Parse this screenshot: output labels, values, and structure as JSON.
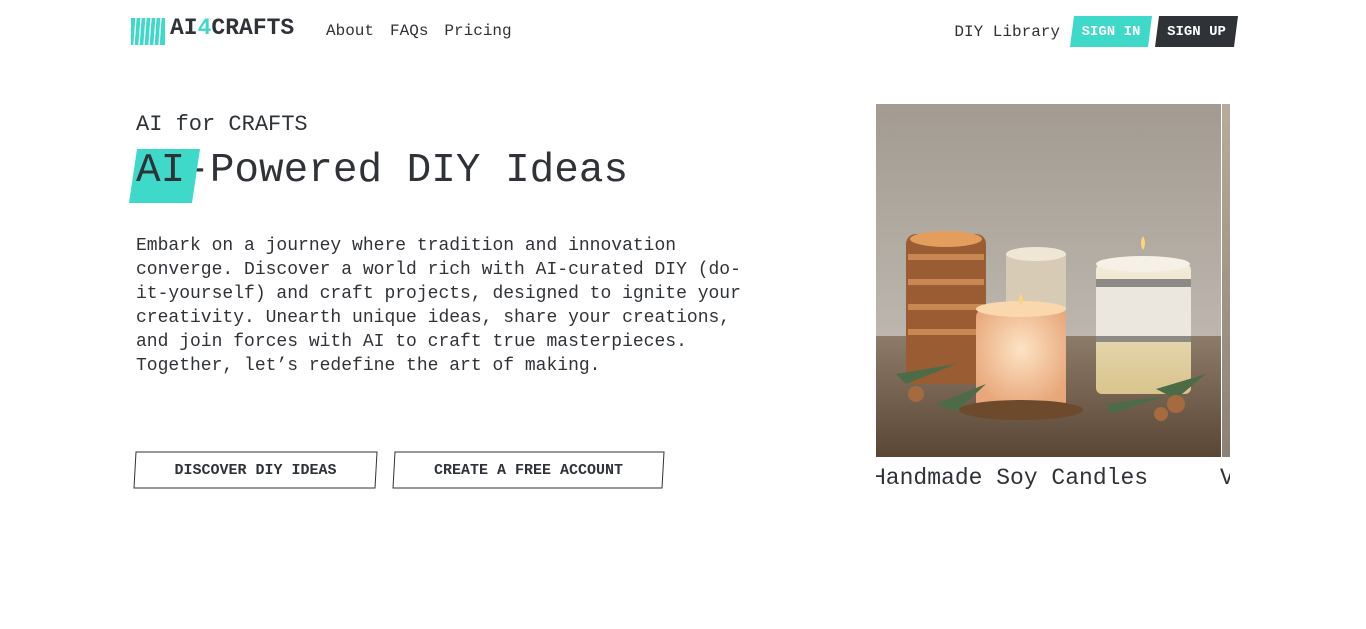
{
  "brand": {
    "prefix": "AI",
    "accent": "4",
    "suffix": "CRAFTS",
    "accent_color": "#3fd9c9",
    "dark_color": "#2f3237"
  },
  "nav": {
    "about": "About",
    "faqs": "FAQs",
    "pricing": "Pricing"
  },
  "account": {
    "library": "DIY Library",
    "sign_in": "SIGN IN",
    "sign_up": "SIGN UP"
  },
  "hero": {
    "eyebrow": "AI for CRAFTS",
    "headline_highlight": "AI",
    "headline_rest": "-Powered DIY Ideas",
    "description": "Embark on a journey where tradition and innovation converge. Discover a world rich with AI-curated DIY (do-it-yourself) and craft projects, designed to ignite your creativity. Unearth unique ideas, share your creations, and join forces with AI to craft true masterpieces. Together, let’s redefine the art of making.",
    "cta_discover": "DISCOVER DIY IDEAS",
    "cta_create": "CREATE A FREE ACCOUNT"
  },
  "carousel": {
    "slides": [
      {
        "caption": "Handmade Soy Candles",
        "image": "candles-photo"
      },
      {
        "caption": "V",
        "image": "craft-photo"
      }
    ]
  }
}
